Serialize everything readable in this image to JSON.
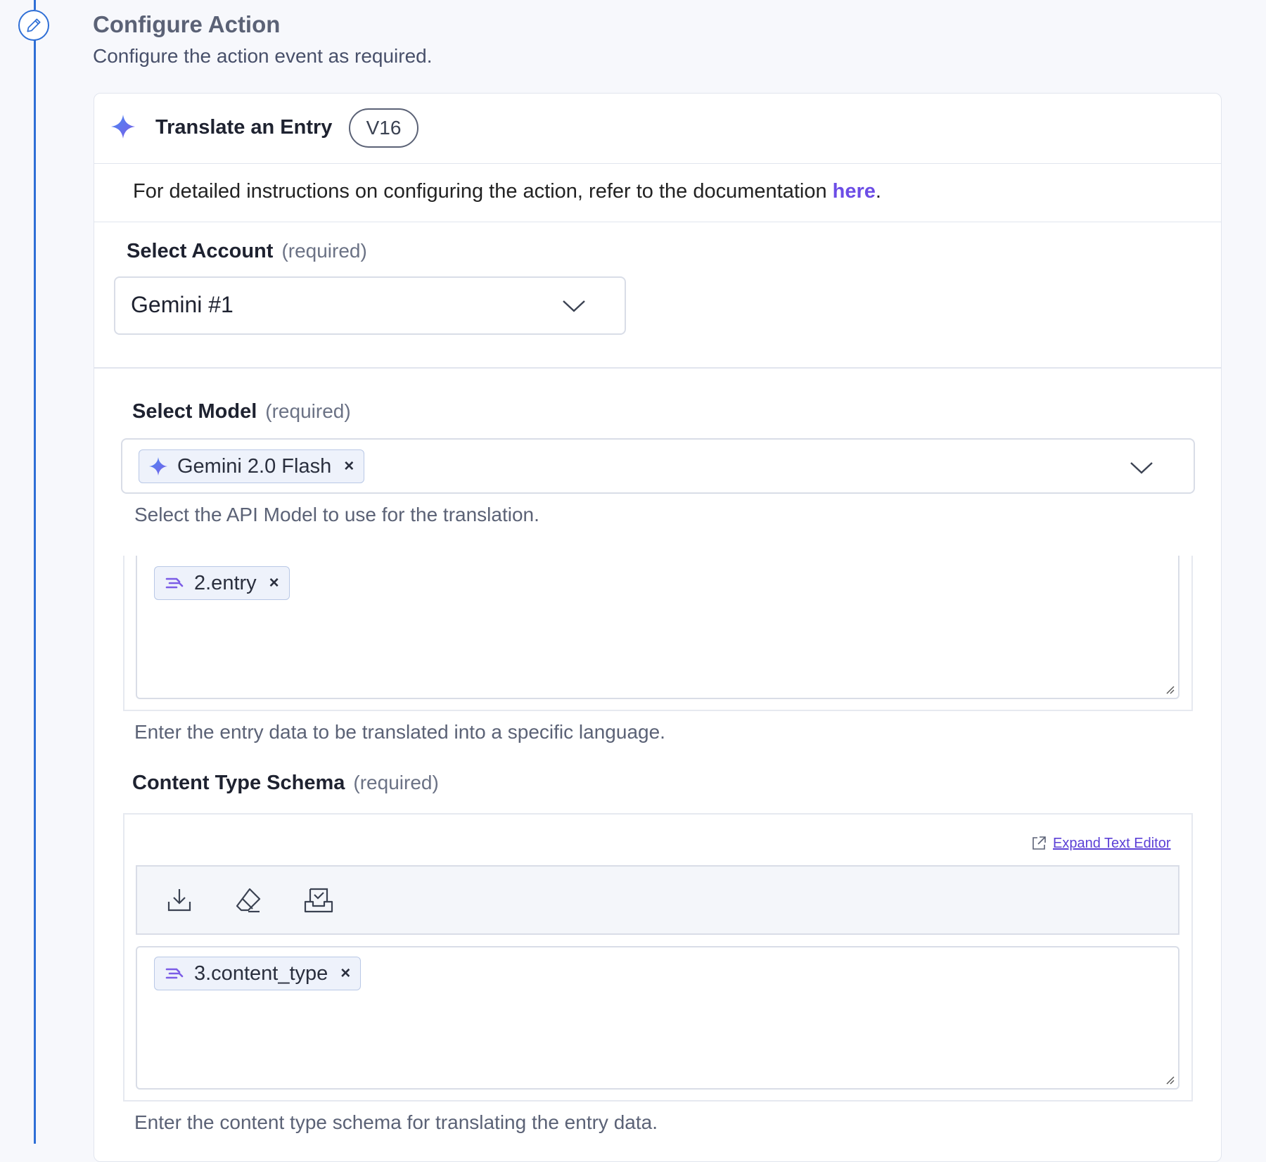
{
  "step": {
    "title": "Configure Action",
    "subtitle": "Configure the action event as required."
  },
  "action": {
    "name": "Translate an Entry",
    "version": "V16",
    "doc_text": "For detailed instructions on configuring the action, refer to the documentation ",
    "doc_link": "here",
    "doc_end": "."
  },
  "account": {
    "label": "Select Account",
    "required": "(required)",
    "value": "Gemini #1"
  },
  "model": {
    "label": "Select Model",
    "required": "(required)",
    "chip": "Gemini 2.0 Flash",
    "remove": "×",
    "help": "Select the API Model to use for the translation."
  },
  "entry": {
    "chip": "2.entry",
    "remove": "×",
    "help": "Enter the entry data to be translated into a specific language."
  },
  "schema": {
    "label": "Content Type Schema",
    "required": "(required)",
    "expand": "Expand Text Editor",
    "chip": "3.content_type",
    "remove": "×",
    "help": "Enter the content type schema for translating the entry data."
  },
  "colors": {
    "accent": "#2f6fd6",
    "link": "#6c4de6",
    "chip_bg": "#eef2fb"
  },
  "icons": [
    "pencil-icon",
    "sparkle-icon",
    "chevron-down-icon",
    "variable-icon",
    "download-icon",
    "eraser-icon",
    "inbox-check-icon",
    "external-link-icon"
  ]
}
